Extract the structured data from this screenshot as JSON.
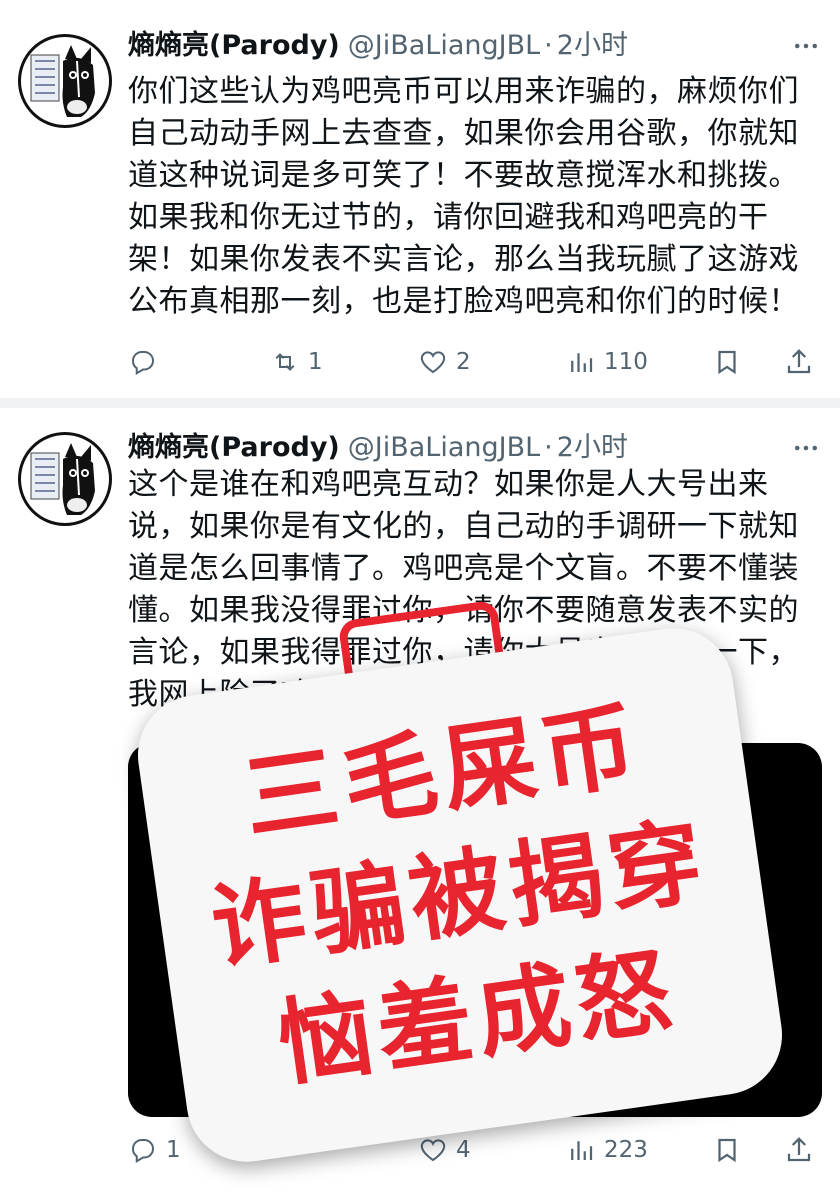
{
  "colors": {
    "text": "#0f1419",
    "muted": "#536471",
    "separator": "#eff3f4",
    "stamp_red": "#e8242f"
  },
  "tweets": [
    {
      "name": "熵熵亮(Parody)",
      "handle": "@JiBaLiangJBL",
      "dot": "·",
      "time": "2小时",
      "text": "你们这些认为鸡吧亮币可以用来诈骗的，麻烦你们自己动动手网上去查查，如果你会用谷歌，你就知道这种说词是多可笑了！不要故意搅浑水和挑拨。如果我和你无过节的，请你回避我和鸡吧亮的干架！如果你发表不实言论，那么当我玩腻了这游戏公布真相那一刻，也是打脸鸡吧亮和你们的时候！",
      "replies": "",
      "retweets": "1",
      "likes": "2",
      "views": "110"
    },
    {
      "name": "熵熵亮(Parody)",
      "handle": "@JiBaLiangJBL",
      "dot": "·",
      "time": "2小时",
      "text": "这个是谁在和鸡吧亮互动？如果你是人大号出来说，如果你是有文化的，自己动的手调研一下就知道是怎么回事情了。鸡吧亮是个文盲。不要不懂装懂。如果我没得罪过你，请你不要随意发表不实的言论，如果我得罪过你，请你大号出来解释一下，我网上除了鸡吧亮没仇人！",
      "replies": "1",
      "retweets": "",
      "likes": "4",
      "views": "223"
    }
  ],
  "stamp": {
    "line1": "三毛屎币",
    "line2": "诈骗被揭穿",
    "line3": "恼羞成怒"
  },
  "icons": [
    "avatar-donkey-icon",
    "more-icon",
    "reply-icon",
    "retweet-icon",
    "like-icon",
    "views-icon",
    "bookmark-icon",
    "share-icon"
  ]
}
